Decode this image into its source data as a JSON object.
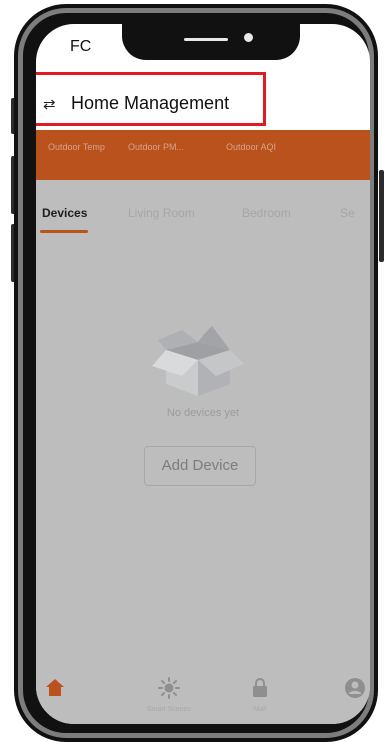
{
  "status_bar": {
    "carrier": "FC"
  },
  "header": {
    "home_icon": "home-icon",
    "title": "Home Management"
  },
  "weather": {
    "items": [
      "Outdoor Temp",
      "Outdoor PM...",
      "Outdoor AQI"
    ]
  },
  "tabs": {
    "items": [
      {
        "label": "Devices",
        "active": true
      },
      {
        "label": "Living Room",
        "active": false
      },
      {
        "label": "Bedroom",
        "active": false
      },
      {
        "label": "Se",
        "active": false
      }
    ]
  },
  "empty_state": {
    "icon": "empty-box-icon",
    "message": "No devices yet",
    "add_button": "Add Device"
  },
  "bottom_nav": {
    "items": [
      {
        "icon": "home-icon",
        "label": ""
      },
      {
        "icon": "sun-icon",
        "label": "Smart Scenes"
      },
      {
        "icon": "lock-icon",
        "label": "Mall"
      },
      {
        "icon": "profile-icon",
        "label": ""
      }
    ]
  },
  "colors": {
    "accent": "#b9521c",
    "highlight_box": "#e01b24",
    "overlay": "#bdbdbd"
  }
}
